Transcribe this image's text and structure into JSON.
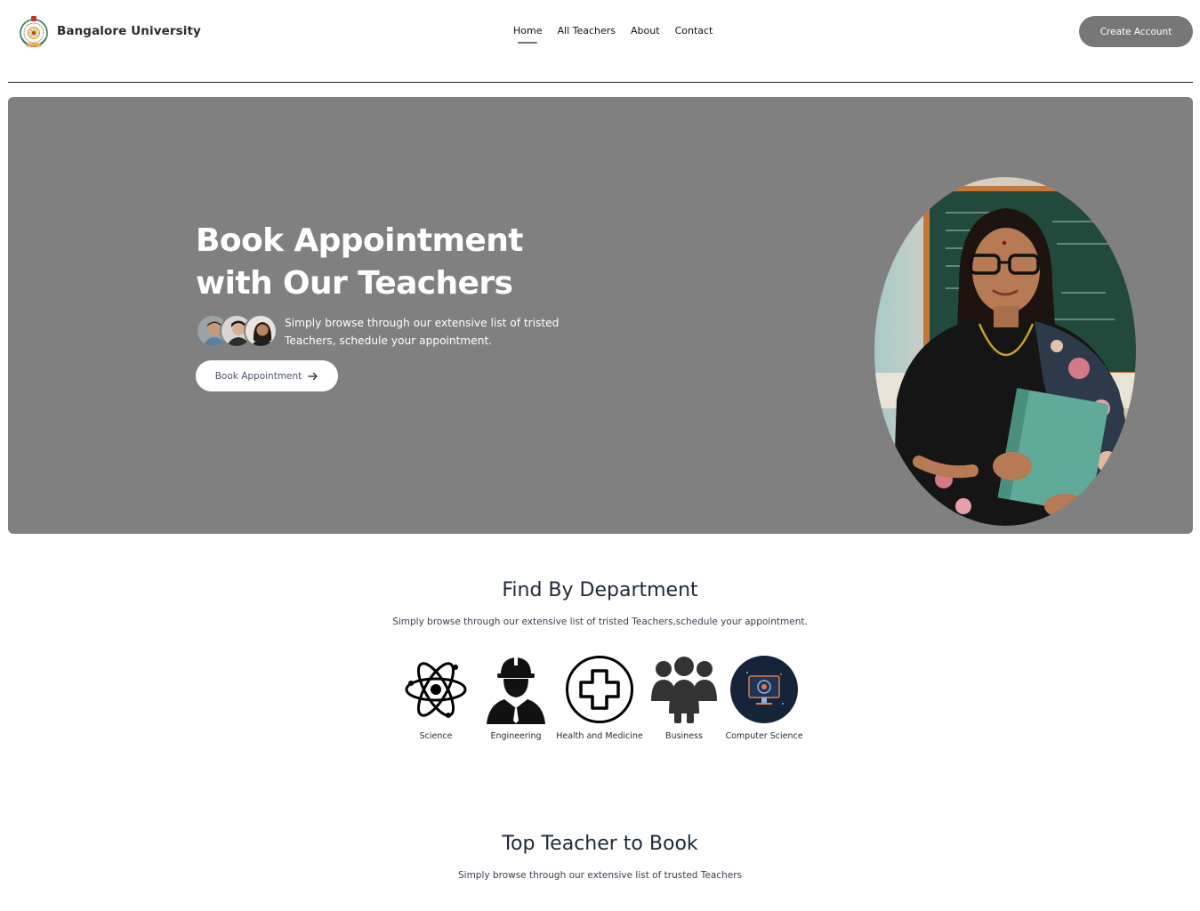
{
  "header": {
    "brand_name": "Bangalore University",
    "nav": [
      {
        "label": "Home",
        "active": true
      },
      {
        "label": "All Teachers",
        "active": false
      },
      {
        "label": "About",
        "active": false
      },
      {
        "label": "Contact",
        "active": false
      }
    ],
    "create_account_label": "Create Account"
  },
  "hero": {
    "title_line1": "Book Appointment",
    "title_line2": "with Our Teachers",
    "description": "Simply browse through our extensive list of tristed Teachers, schedule your appointment.",
    "button_label": "Book Appointment",
    "button_icon": "arrow-right-icon",
    "background_color": "#808080"
  },
  "departments": {
    "title": "Find By Department",
    "subtitle": "Simply browse through our extensive list of tristed Teachers,schedule your appointment.",
    "items": [
      {
        "label": "Science",
        "icon": "atom-icon"
      },
      {
        "label": "Engineering",
        "icon": "engineer-icon"
      },
      {
        "label": "Health and Medicine",
        "icon": "medical-cross-icon"
      },
      {
        "label": "Business",
        "icon": "people-group-icon"
      },
      {
        "label": "Computer Science",
        "icon": "computer-monitor-icon"
      }
    ]
  },
  "top_teachers": {
    "title": "Top Teacher to Book",
    "subtitle": "Simply browse through our extensive list of trusted Teachers"
  }
}
